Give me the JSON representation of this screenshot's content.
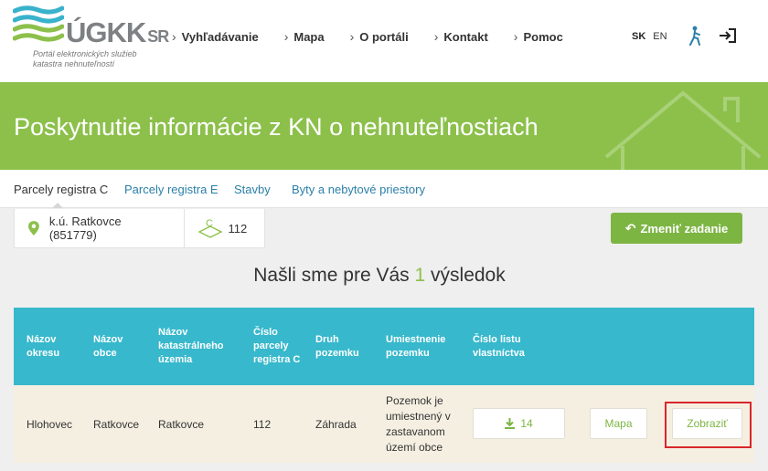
{
  "header": {
    "logo_text": "ÚGKK",
    "logo_suffix": "SR",
    "logo_subtitle": "Portál elektronických služieb katastra nehnuteľností",
    "nav": [
      "Vyhľadávanie",
      "Mapa",
      "O portáli",
      "Kontakt",
      "Pomoc"
    ],
    "lang_active": "SK",
    "lang_other": "EN"
  },
  "banner": {
    "title": "Poskytnutie informácie z KN o nehnuteľnostiach"
  },
  "tabs": [
    "Parcely registra C",
    "Parcely registra E",
    "Stavby",
    "Byty a nebytové priestory"
  ],
  "filter": {
    "location": "k.ú. Ratkovce (851779)",
    "parcel": "112",
    "change_button": "Zmeniť zadanie"
  },
  "result": {
    "prefix": "Našli sme pre Vás",
    "count": "1",
    "suffix": "výsledok"
  },
  "table": {
    "headers": [
      "Názov okresu",
      "Názov obce",
      "Názov katastrálneho územia",
      "Číslo parcely registra C",
      "Druh pozemku",
      "Umiestnenie pozemku",
      "Číslo listu vlastníctva"
    ],
    "row": {
      "okres": "Hlohovec",
      "obec": "Ratkovce",
      "ku": "Ratkovce",
      "parcela": "112",
      "druh": "Záhrada",
      "umiestnenie": "Pozemok je umiestnený v zastavanom území obce",
      "lv": "14",
      "map_button": "Mapa",
      "show_button": "Zobraziť"
    }
  },
  "colors": {
    "green": "#8cc04b",
    "button_green": "#7db543",
    "table_header": "#37b8cc",
    "row_bg": "#f5efe2",
    "link_blue": "#2b7fa8",
    "highlight_red": "#d9262a"
  },
  "icons": [
    "location-pin-icon",
    "parcel-icon",
    "accessibility-icon",
    "login-icon",
    "download-icon",
    "undo-arrow-icon"
  ]
}
